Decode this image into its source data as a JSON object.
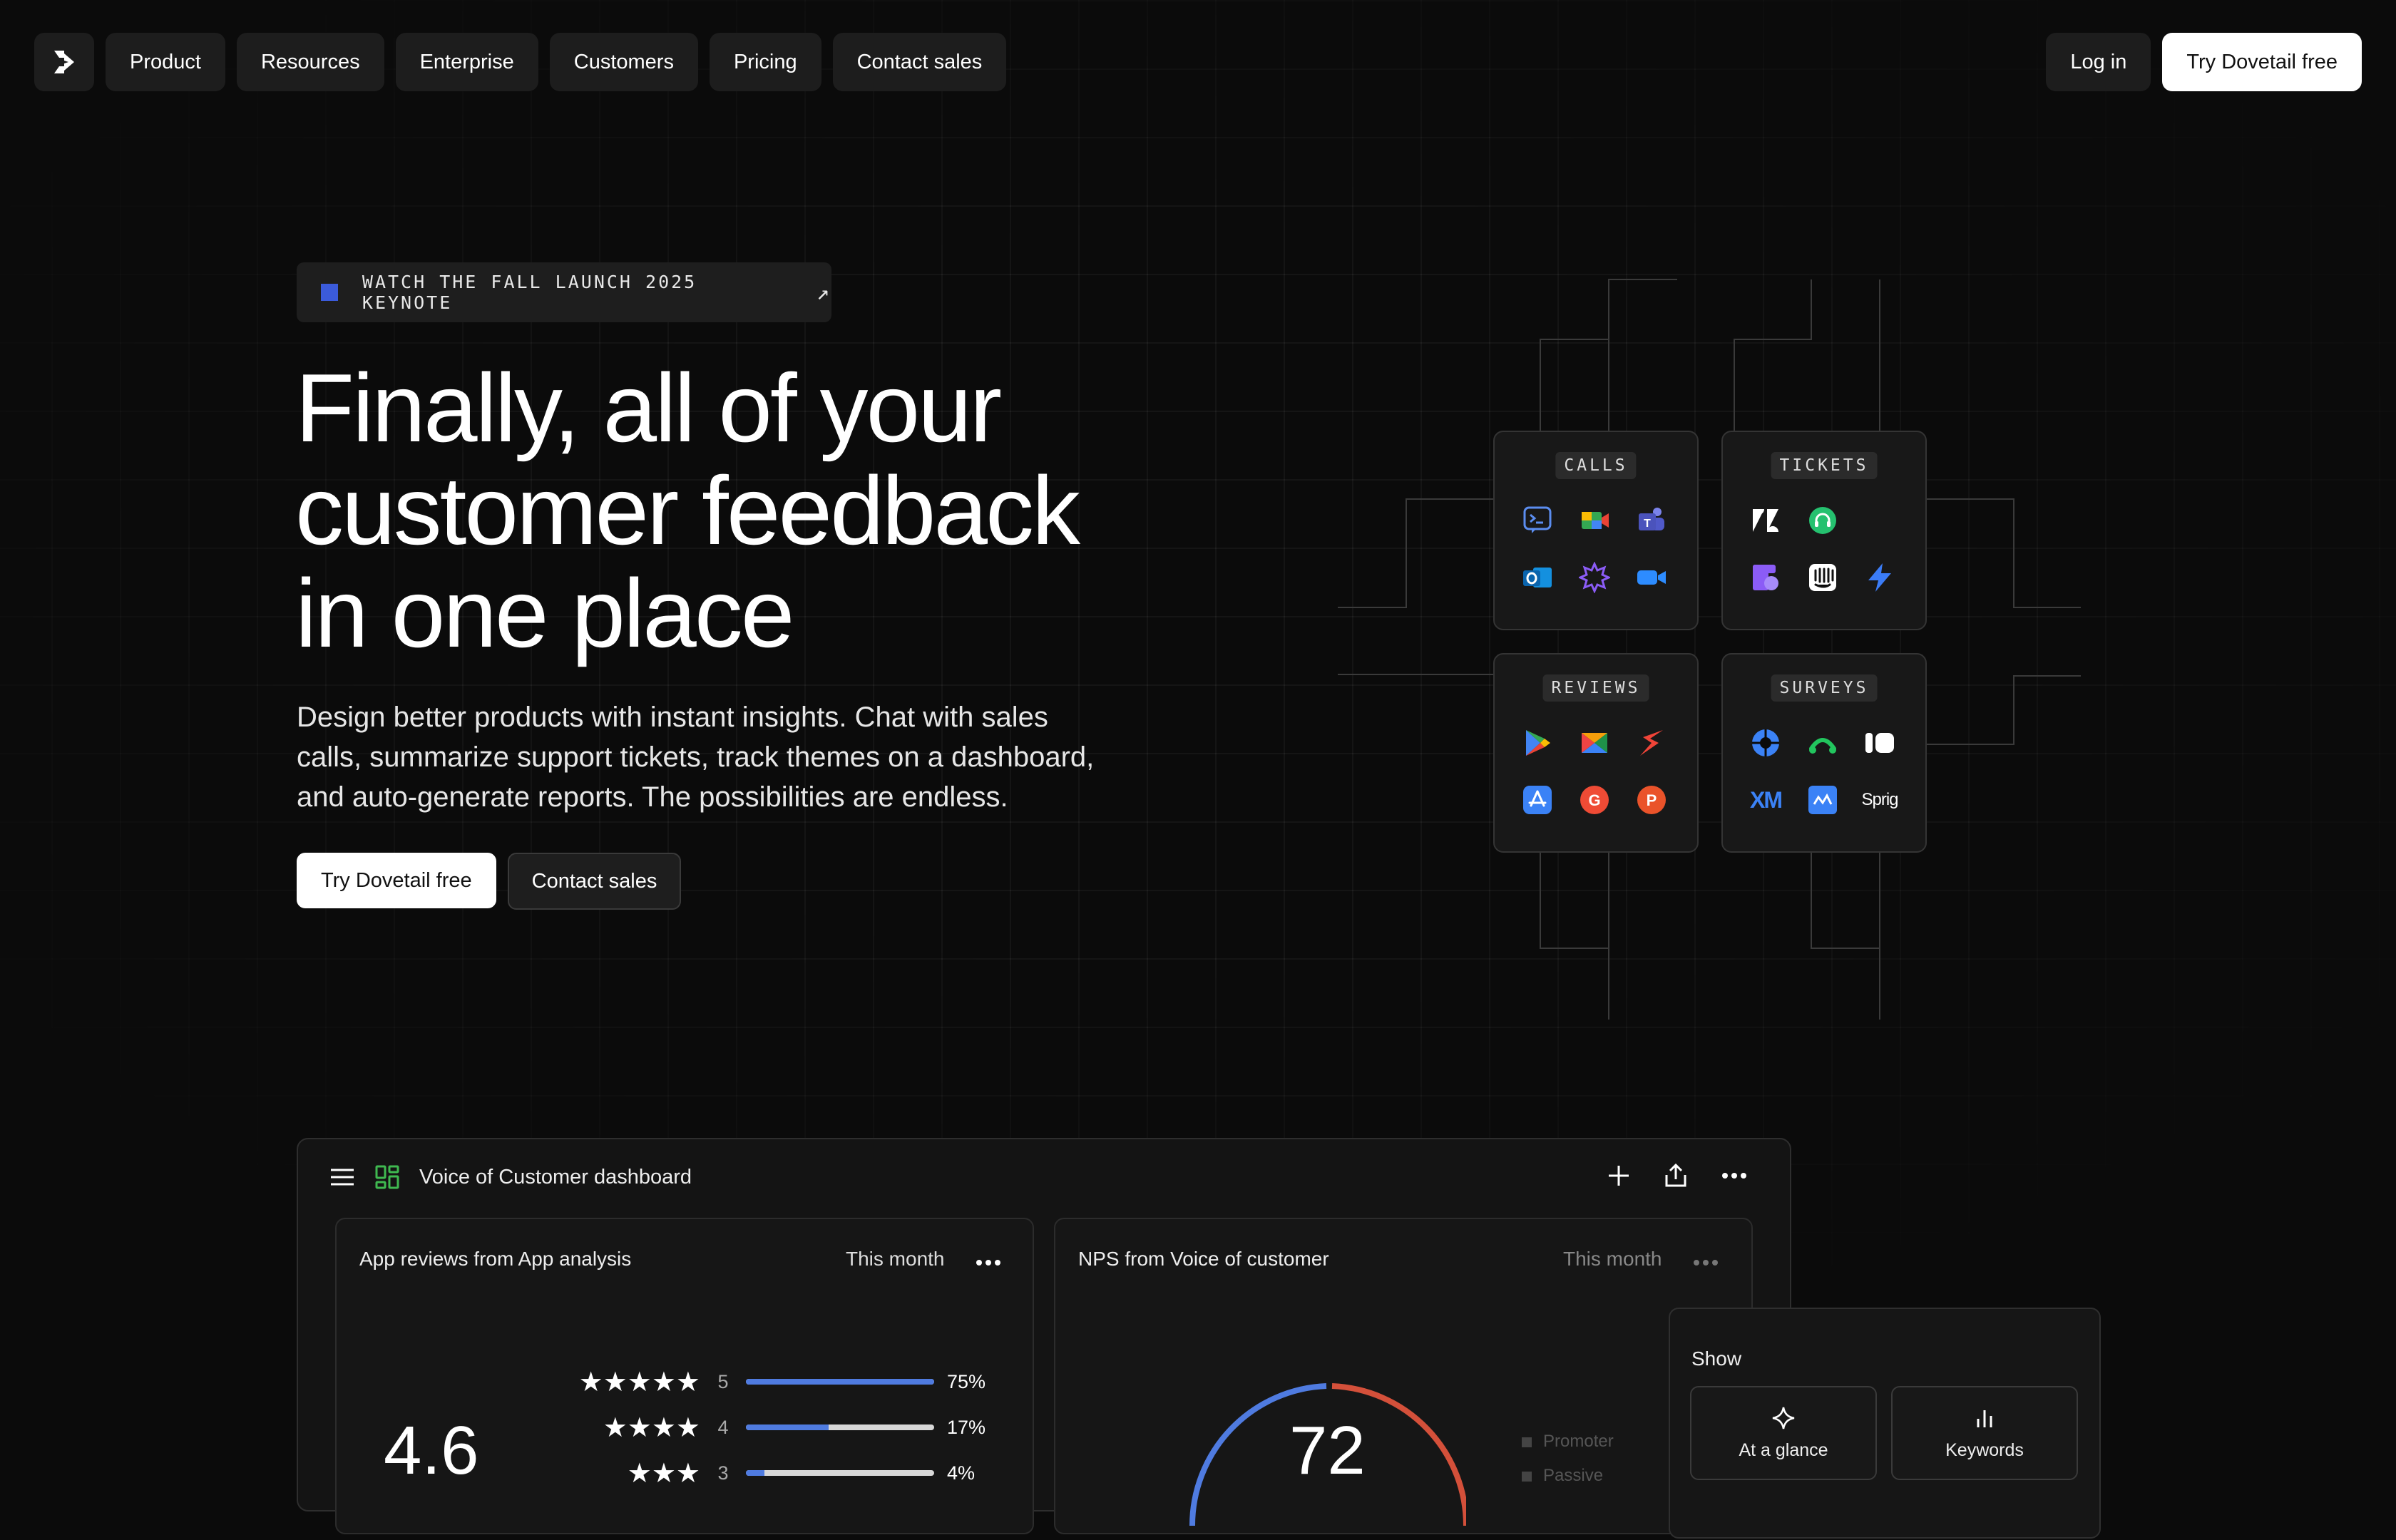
{
  "nav": {
    "items": [
      "Product",
      "Resources",
      "Enterprise",
      "Customers",
      "Pricing",
      "Contact sales"
    ],
    "login": "Log in",
    "try_free": "Try Dovetail free"
  },
  "hero": {
    "announcement": "WATCH THE FALL LAUNCH 2025 KEYNOTE",
    "title_lines": [
      "Finally, all of your",
      "customer feedback",
      "in one place"
    ],
    "subtitle_lines": [
      "Design better products with instant insights. Chat with sales",
      "calls, summarize support tickets, track themes on a dashboard,",
      "and auto-generate reports. The possibilities are endless."
    ],
    "cta_primary": "Try Dovetail free",
    "cta_secondary": "Contact sales"
  },
  "integrations": {
    "calls": {
      "label": "CALLS",
      "icons": [
        "terminal-chat-icon",
        "google-meet-icon",
        "teams-icon",
        "outlook-icon",
        "gong-icon",
        "zoom-icon"
      ]
    },
    "tickets": {
      "label": "TICKETS",
      "icons": [
        "zendesk-icon",
        "freshdesk-icon",
        "front-icon",
        "intercom-icon",
        "bolt-icon"
      ]
    },
    "reviews": {
      "label": "REVIEWS",
      "icons": [
        "google-play-icon",
        "trustpilot-icon",
        "sketch-icon",
        "app-store-icon",
        "g2-icon",
        "producthunt-icon"
      ]
    },
    "surveys": {
      "label": "SURVEYS",
      "icons": [
        "qualtrics-icon",
        "surveymonkey-icon",
        "typeform-icon",
        "xm-icon",
        "maze-icon",
        "sprig-icon"
      ],
      "text_logos": {
        "xm": "XM",
        "sprig": "Sprig"
      }
    }
  },
  "dashboard": {
    "title": "Voice of Customer dashboard",
    "app_reviews": {
      "title": "App reviews from App analysis",
      "period": "This month",
      "average": "4.6",
      "ratings": [
        {
          "stars": 5,
          "label": "5",
          "percent": "75%",
          "fill": 1.0
        },
        {
          "stars": 4,
          "label": "4",
          "percent": "17%",
          "fill": 0.44
        },
        {
          "stars": 3,
          "label": "3",
          "percent": "4%",
          "fill": 0.1
        }
      ]
    },
    "nps": {
      "title": "NPS from Voice of customer",
      "period": "This month",
      "score": "72",
      "legend": [
        "Promoter",
        "Passive"
      ]
    },
    "show": {
      "label": "Show",
      "options": [
        "At a glance",
        "Keywords"
      ]
    }
  },
  "colors": {
    "accent_blue": "#3b5bdb",
    "nps_blue": "#4f7be0",
    "nps_red": "#d4503a"
  }
}
